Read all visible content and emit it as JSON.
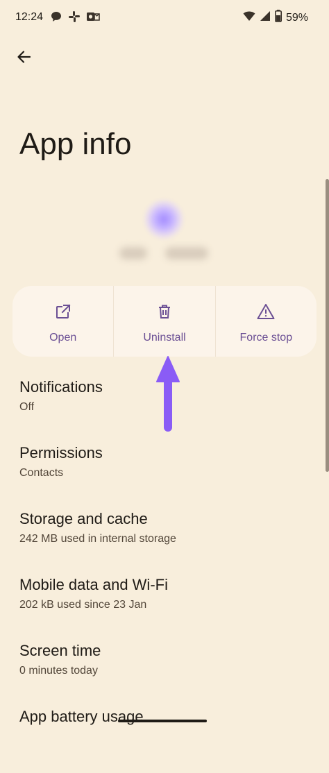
{
  "status_bar": {
    "time": "12:24",
    "battery": "59%",
    "icons": [
      "chat-bubble-icon",
      "slack-icon",
      "outlook-icon",
      "wifi-icon",
      "signal-icon",
      "battery-icon"
    ]
  },
  "header": {
    "title": "App info",
    "back_icon": "back-arrow-icon"
  },
  "actions": [
    {
      "label": "Open",
      "icon": "open-external-icon"
    },
    {
      "label": "Uninstall",
      "icon": "trash-icon"
    },
    {
      "label": "Force stop",
      "icon": "warning-triangle-icon"
    }
  ],
  "settings": [
    {
      "title": "Notifications",
      "subtitle": "Off"
    },
    {
      "title": "Permissions",
      "subtitle": "Contacts"
    },
    {
      "title": "Storage and cache",
      "subtitle": "242 MB used in internal storage"
    },
    {
      "title": "Mobile data and Wi-Fi",
      "subtitle": "202 kB used since 23 Jan"
    },
    {
      "title": "Screen time",
      "subtitle": "0 minutes today"
    },
    {
      "title": "App battery usage",
      "subtitle": ""
    }
  ],
  "colors": {
    "background": "#f8eedc",
    "card": "#fcf4ea",
    "accent": "#6b4f94",
    "annotation_arrow": "#8a5cf6"
  }
}
